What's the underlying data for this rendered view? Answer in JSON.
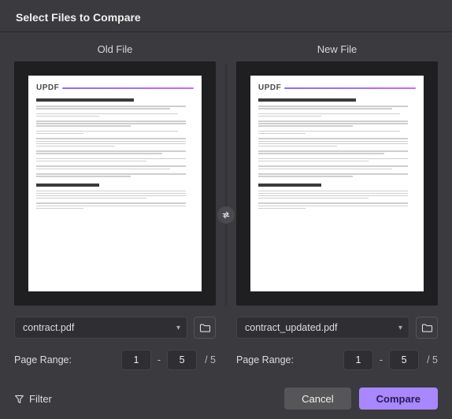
{
  "dialog": {
    "title": "Select Files to Compare"
  },
  "old": {
    "title": "Old File",
    "filename": "contract.pdf",
    "logo": "UPDF",
    "page_range_label": "Page Range:",
    "from": "1",
    "to": "5",
    "total": "/ 5"
  },
  "new": {
    "title": "New File",
    "filename": "contract_updated.pdf",
    "logo": "UPDF",
    "page_range_label": "Page Range:",
    "from": "1",
    "to": "5",
    "total": "/ 5"
  },
  "footer": {
    "filter": "Filter",
    "cancel": "Cancel",
    "compare": "Compare"
  },
  "range_dash": "-"
}
